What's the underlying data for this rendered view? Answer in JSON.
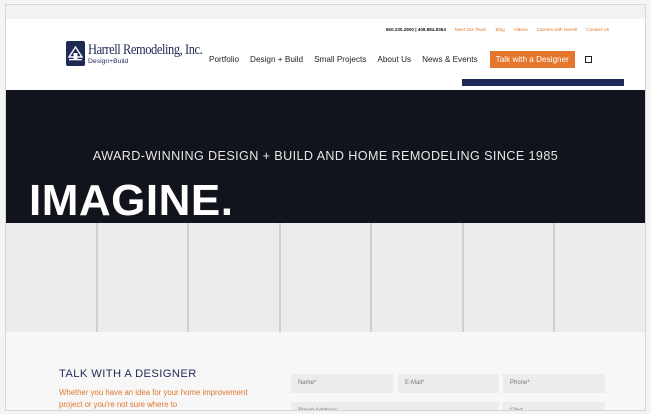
{
  "utility": {
    "phone": "650.230.2900 | 408.884.8364",
    "links": [
      "Meet Our Team",
      "Blog",
      "Videos",
      "Careers with Harrell",
      "Contact Us"
    ]
  },
  "logo": {
    "name": "Harrell Remodeling, Inc.",
    "tagline": "Design+Build"
  },
  "nav": {
    "items": [
      "Portfolio",
      "Design + Build",
      "Small Projects",
      "About Us",
      "News & Events"
    ],
    "cta": "Talk with a Designer",
    "extra_icon": "square-icon"
  },
  "hero": {
    "tagline": "AWARD-WINNING DESIGN + BUILD AND HOME REMODELING SINCE 1985",
    "title": "IMAGINE."
  },
  "contact": {
    "title": "TALK WITH A DESIGNER",
    "description": "Whether you have an idea for your home improvement project or you're not sure where to",
    "fields": {
      "name": "Name*",
      "email": "E-Mail*",
      "phone": "Phone*",
      "street": "Street Address",
      "city": "City*"
    }
  },
  "colors": {
    "accent": "#e4762e",
    "brand_navy": "#1e2a55",
    "hero_bg": "#12141d"
  }
}
